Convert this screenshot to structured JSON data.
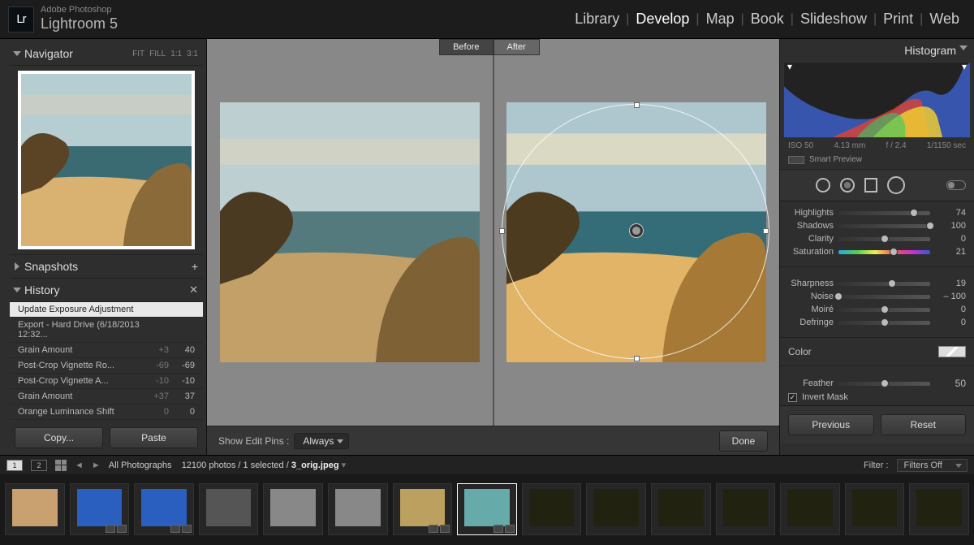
{
  "brand_small": "Adobe Photoshop",
  "brand_big": "Lightroom 5",
  "logo": "Lr",
  "modules": [
    "Library",
    "Develop",
    "Map",
    "Book",
    "Slideshow",
    "Print",
    "Web"
  ],
  "active_module": "Develop",
  "navigator": {
    "title": "Navigator",
    "opts": [
      "FIT",
      "FILL",
      "1:1",
      "3:1"
    ]
  },
  "snapshots": {
    "title": "Snapshots"
  },
  "history": {
    "title": "History",
    "items": [
      {
        "label": "Update Exposure Adjustment",
        "v1": "",
        "v2": "",
        "sel": true
      },
      {
        "label": "Export - Hard Drive (6/18/2013 12:32...",
        "v1": "",
        "v2": ""
      },
      {
        "label": "Grain Amount",
        "v1": "+3",
        "v2": "40"
      },
      {
        "label": "Post-Crop Vignette Ro...",
        "v1": "-69",
        "v2": "-69"
      },
      {
        "label": "Post-Crop Vignette A...",
        "v1": "-10",
        "v2": "-10"
      },
      {
        "label": "Grain Amount",
        "v1": "+37",
        "v2": "37"
      },
      {
        "label": "Orange Luminance Shift",
        "v1": "0",
        "v2": "0"
      }
    ]
  },
  "copy": "Copy...",
  "paste": "Paste",
  "before": "Before",
  "after": "After",
  "edit_pins_label": "Show Edit Pins :",
  "edit_pins_value": "Always",
  "done": "Done",
  "histogram_label": "Histogram",
  "meta": {
    "iso": "ISO 50",
    "focal": "4.13 mm",
    "ap": "f / 2.4",
    "shutter": "1/1150 sec"
  },
  "smart": "Smart Preview",
  "sliders_a": [
    {
      "k": "Highlights",
      "v": "74",
      "pos": 82
    },
    {
      "k": "Shadows",
      "v": "100",
      "pos": 100
    },
    {
      "k": "Clarity",
      "v": "0",
      "pos": 50
    },
    {
      "k": "Saturation",
      "v": "21",
      "pos": 60,
      "hue": true
    }
  ],
  "sliders_b": [
    {
      "k": "Sharpness",
      "v": "19",
      "pos": 58
    },
    {
      "k": "Noise",
      "v": "– 100",
      "pos": 0
    },
    {
      "k": "Moiré",
      "v": "0",
      "pos": 50
    },
    {
      "k": "Defringe",
      "v": "0",
      "pos": 50
    }
  ],
  "color_label": "Color",
  "feather": {
    "k": "Feather",
    "v": "50",
    "pos": 50
  },
  "invert": "Invert Mask",
  "previous": "Previous",
  "reset": "Reset",
  "crumb_all": "All Photographs",
  "crumb_count": "12100 photos / 1 selected /",
  "crumb_file": "3_orig.jpeg",
  "filter_label": "Filter :",
  "filter_value": "Filters Off",
  "monitors": [
    "1",
    "2"
  ],
  "film_thumbs": [
    {
      "c": "#c9a070"
    },
    {
      "c": "#2a5fbf",
      "b": true
    },
    {
      "c": "#2a5fbf",
      "b": true
    },
    {
      "c": "#555"
    },
    {
      "c": "#888"
    },
    {
      "c": "#888"
    },
    {
      "c": "#bca060",
      "b": true
    },
    {
      "c": "#6aa",
      "b": true,
      "active": true
    },
    {
      "c": "#221"
    },
    {
      "c": "#221"
    },
    {
      "c": "#221"
    },
    {
      "c": "#221"
    },
    {
      "c": "#221"
    },
    {
      "c": "#221"
    },
    {
      "c": "#221"
    }
  ]
}
